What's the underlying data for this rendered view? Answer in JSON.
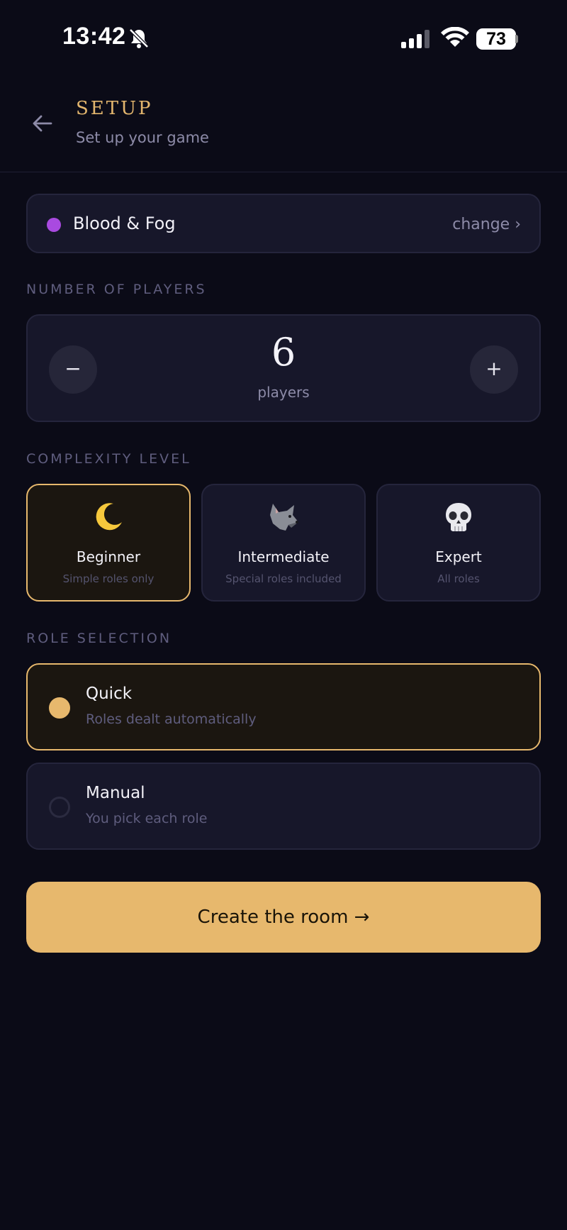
{
  "status_bar": {
    "time": "13:42",
    "battery": "73",
    "icons": [
      "bell-slash-icon",
      "signal-icon",
      "wifi-icon"
    ]
  },
  "header": {
    "title": "SETUP",
    "subtitle": "Set up your game"
  },
  "theme": {
    "name": "Blood & Fog",
    "change_label": "change ›",
    "dot_color": "#a94ae0"
  },
  "players": {
    "section_label": "NUMBER OF PLAYERS",
    "count": "6",
    "unit": "players",
    "minus_label": "−",
    "plus_label": "+"
  },
  "complexity": {
    "section_label": "COMPLEXITY LEVEL",
    "levels": [
      {
        "icon": "crescent-moon-icon",
        "name": "Beginner",
        "desc": "Simple roles only",
        "selected": true
      },
      {
        "icon": "wolf-icon",
        "name": "Intermediate",
        "desc": "Special roles included",
        "selected": false
      },
      {
        "icon": "skull-icon",
        "name": "Expert",
        "desc": "All roles",
        "selected": false
      }
    ]
  },
  "role_selection": {
    "section_label": "ROLE SELECTION",
    "options": [
      {
        "name": "Quick",
        "desc": "Roles dealt automatically",
        "selected": true
      },
      {
        "name": "Manual",
        "desc": "You pick each role",
        "selected": false
      }
    ]
  },
  "cta": {
    "label": "Create the room →"
  },
  "colors": {
    "background": "#0b0b17",
    "accent": "#e7b86d",
    "card": "#17172a"
  }
}
